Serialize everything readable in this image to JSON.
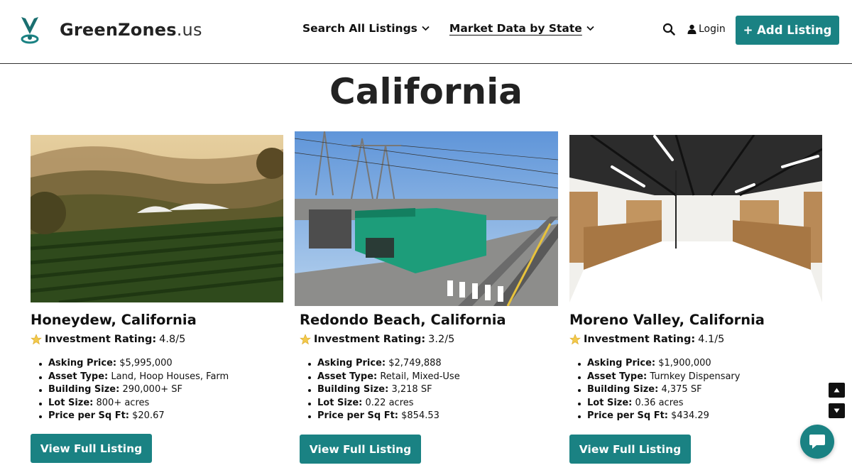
{
  "header": {
    "logo_name": "GreenZones",
    "logo_tld": ".us",
    "nav": [
      {
        "label": "Search All Listings"
      },
      {
        "label": "Market Data by State"
      }
    ],
    "login_label": "Login",
    "add_listing_label": "+ Add Listing"
  },
  "page": {
    "title": "California"
  },
  "listings": [
    {
      "title": "Honeydew, California",
      "rating_label": "Investment Rating:",
      "rating_value": "4.8/5",
      "specs": [
        {
          "label": "Asking Price:",
          "value": "$5,995,000"
        },
        {
          "label": "Asset Type:",
          "value": "Land, Hoop Houses, Farm"
        },
        {
          "label": "Building Size:",
          "value": "290,000+ SF"
        },
        {
          "label": "Lot Size:",
          "value": "800+ acres"
        },
        {
          "label": "Price per Sq Ft:",
          "value": "$20.67"
        }
      ],
      "button_label": "View Full Listing"
    },
    {
      "title": "Redondo Beach, California",
      "rating_label": "Investment Rating:",
      "rating_value": "3.2/5",
      "specs": [
        {
          "label": "Asking Price:",
          "value": "$2,749,888"
        },
        {
          "label": "Asset Type:",
          "value": "Retail, Mixed-Use"
        },
        {
          "label": "Building Size:",
          "value": "3,218 SF"
        },
        {
          "label": "Lot Size:",
          "value": "0.22 acres"
        },
        {
          "label": "Price per Sq Ft:",
          "value": "$854.53"
        }
      ],
      "button_label": "View Full Listing"
    },
    {
      "title": "Moreno Valley, California",
      "rating_label": "Investment Rating:",
      "rating_value": "4.1/5",
      "specs": [
        {
          "label": "Asking Price:",
          "value": "$1,900,000"
        },
        {
          "label": "Asset Type:",
          "value": "Turnkey Dispensary"
        },
        {
          "label": "Building Size:",
          "value": "4,375 SF"
        },
        {
          "label": "Lot Size:",
          "value": "0.36 acres"
        },
        {
          "label": "Price per Sq Ft:",
          "value": "$434.29"
        }
      ],
      "button_label": "View Full Listing"
    }
  ],
  "colors": {
    "accent": "#1a8283",
    "text": "#111111"
  },
  "icons": {
    "logo": "location-pin-icon",
    "search": "search-icon",
    "login": "user-icon",
    "rating": "star-icon",
    "scroll_up": "arrow-up-icon",
    "scroll_down": "arrow-down-icon",
    "chat": "chat-bubble-icon"
  }
}
